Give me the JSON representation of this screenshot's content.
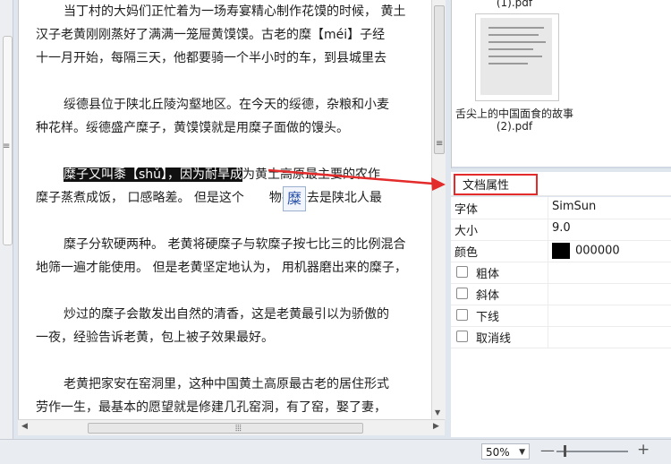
{
  "document": {
    "lines": [
      "当丁村的大妈们正忙着为一场寿宴精心制作花馍的时候，  黄土",
      "汉子老黄刚刚蒸好了满满一笼屉黄馍馍。古老的糜【méi】子经",
      "十一月开始，每隔三天，他都要骑一个半小时的车，到县城里去",
      "绥德县位于陕北丘陵沟壑地区。在今天的绥德，杂粮和小麦",
      "种花样。绥德盛产糜子，黄馍馍就是用糜子面做的馒头。",
      "糜子又叫黍【shǔ】，因为耐旱成",
      "为黄土高原最主要的农作",
      "糜子蒸煮成饭，   口感略差。  但是这个",
      "物在过去是陕北人最",
      "糜子分软硬两种。  老黄将硬糜子与软糜子按七比三的比例混合",
      "地筛一遍才能使用。  但是老黄坚定地认为，  用机器磨出来的糜子，",
      "炒过的糜子会散发出自然的清香，这是老黄最引以为骄傲的",
      "一夜，经验告诉老黄，包上被子效果最好。",
      "老黄把家安在窑洞里，这种中国黄土高原最古老的居住形式",
      "劳作一生，最基本的愿望就是修建几孔窑洞，有了窑，娶了妻，"
    ],
    "tooltip_char": "糜"
  },
  "thumbnails": {
    "caption_top": "(1).pdf",
    "caption_line1": "舌尖上的中国面食的故事",
    "caption_line2": "(2).pdf"
  },
  "properties": {
    "title": "文档属性",
    "font_label": "字体",
    "font_value": "SimSun",
    "size_label": "大小",
    "size_value": "9.0",
    "color_label": "颜色",
    "color_value": "000000",
    "color_swatch": "#000000",
    "bold_label": "粗体",
    "italic_label": "斜体",
    "underline_label": "下线",
    "strike_label": "取消线"
  },
  "status": {
    "zoom_value": "50%",
    "zoom_minus": "—",
    "zoom_plus": "+"
  },
  "colors": {
    "highlight": "#111111",
    "annotation": "#e32b2b"
  }
}
